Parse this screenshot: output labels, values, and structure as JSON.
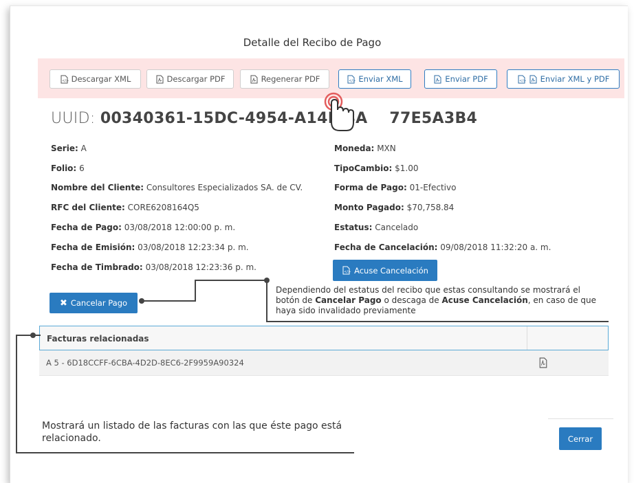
{
  "modal": {
    "title": "Detalle del Recibo de Pago"
  },
  "toolbar": {
    "buttons": [
      {
        "label": "Descargar XML",
        "icon": "xml-file-icon"
      },
      {
        "label": "Descargar PDF",
        "icon": "pdf-file-icon"
      },
      {
        "label": "Regenerar PDF",
        "icon": "pdf-file-icon"
      },
      {
        "label": "Enviar XML",
        "icon": "xml-file-icon"
      },
      {
        "label": "Enviar PDF",
        "icon": "pdf-file-icon"
      },
      {
        "label": "Enviar XML y PDF",
        "icon": "xml-pdf-file-icon"
      }
    ]
  },
  "uuid": {
    "label": "UUID:",
    "value": "00340361-15DC-4954-A14E-8A",
    "value_tail": "77E5A3B4"
  },
  "details": {
    "left": [
      {
        "label": "Serie:",
        "value": "A"
      },
      {
        "label": "Folio:",
        "value": "6"
      },
      {
        "label": "Nombre del Cliente:",
        "value": "Consultores Especializados SA. de CV."
      },
      {
        "label": "RFC del Cliente:",
        "value": "CORE6208164Q5"
      },
      {
        "label": "Fecha de Pago:",
        "value": "03/08/2018 12:00:00 p. m."
      },
      {
        "label": "Fecha de Emisión:",
        "value": "03/08/2018 12:23:34 p. m."
      },
      {
        "label": "Fecha de Timbrado:",
        "value": "03/08/2018 12:23:36 p. m."
      }
    ],
    "right": [
      {
        "label": "Moneda:",
        "value": "MXN"
      },
      {
        "label": "TipoCambio:",
        "value": "$1.00"
      },
      {
        "label": "Forma de Pago:",
        "value": "01-Efectivo"
      },
      {
        "label": "Monto Pagado:",
        "value": "$70,758.84"
      },
      {
        "label": "Estatus:",
        "value": "Cancelado"
      },
      {
        "label": "Fecha de Cancelación:",
        "value": "09/08/2018 11:32:20 a. m."
      }
    ]
  },
  "actions": {
    "acuse_label": "Acuse Cancelación",
    "cancel_label": "Cancelar Pago",
    "close_label": "Cerrar"
  },
  "annotations": {
    "status_note_1": "Dependiendo del estatus del recibo que estas consultando se mostrará el",
    "status_note_2a": "botón de ",
    "status_note_2b": "Cancelar Pago",
    "status_note_2c": " o descaga de ",
    "status_note_2d": "Acuse Cancelación",
    "status_note_2e": ", en caso de que",
    "status_note_3": "haya sido invalidado previamente",
    "list_note_1": "Mostrará un listado de las facturas con las que éste pago está",
    "list_note_2": "relacionado."
  },
  "related_invoices": {
    "header": "Facturas relacionadas",
    "rows": [
      {
        "label": "A 5 - 6D18CCFF-6CBA-4D2D-8EC6-2F9959A90324",
        "icon": "pdf-file-icon"
      }
    ]
  },
  "colors": {
    "accent": "#2a7bc0",
    "toolbar_bg": "#fde4e4",
    "table_border": "#5aa9d6"
  }
}
